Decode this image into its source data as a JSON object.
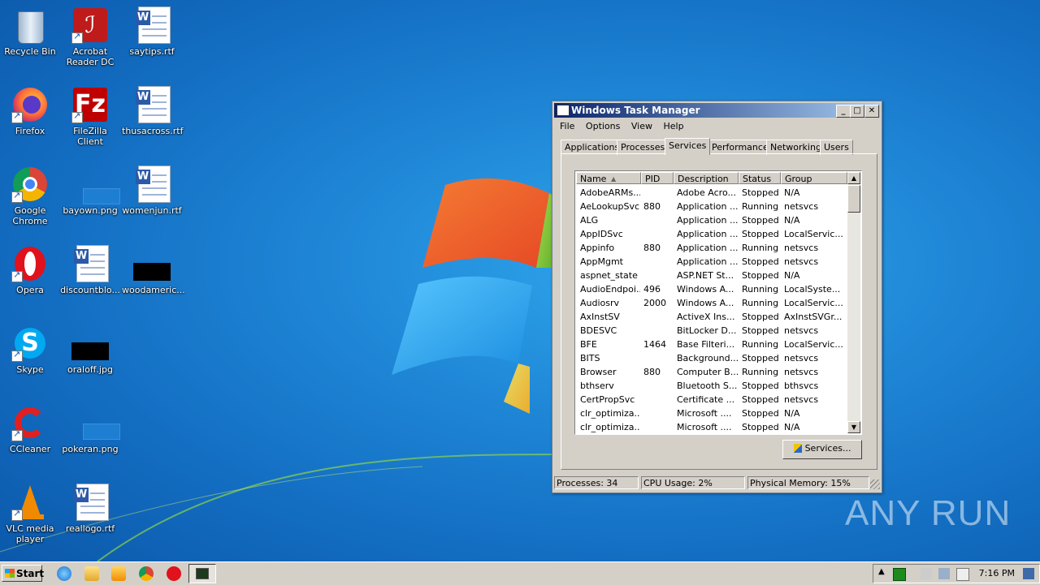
{
  "desktop": {
    "icons": [
      {
        "label": "Recycle Bin"
      },
      {
        "label": "Acrobat Reader DC"
      },
      {
        "label": "saytips.rtf"
      },
      {
        "label": "Firefox"
      },
      {
        "label": "FileZilla Client"
      },
      {
        "label": "thusacross.rtf"
      },
      {
        "label": "Google Chrome"
      },
      {
        "label": "bayown.png"
      },
      {
        "label": "womenjun.rtf"
      },
      {
        "label": "Opera"
      },
      {
        "label": "discountblo..."
      },
      {
        "label": "woodameric..."
      },
      {
        "label": "Skype"
      },
      {
        "label": "oraloff.jpg"
      },
      {
        "label": "CCleaner"
      },
      {
        "label": "pokeran.png"
      },
      {
        "label": "VLC media player"
      },
      {
        "label": "reallogo.rtf"
      }
    ]
  },
  "task_manager": {
    "title": "Windows Task Manager",
    "menu": [
      "File",
      "Options",
      "View",
      "Help"
    ],
    "tabs": [
      "Applications",
      "Processes",
      "Services",
      "Performance",
      "Networking",
      "Users"
    ],
    "active_tab": "Services",
    "columns": [
      "Name",
      "PID",
      "Description",
      "Status",
      "Group"
    ],
    "rows": [
      [
        "AdobeARMs...",
        "",
        "Adobe Acro...",
        "Stopped",
        "N/A"
      ],
      [
        "AeLookupSvc",
        "880",
        "Application ...",
        "Running",
        "netsvcs"
      ],
      [
        "ALG",
        "",
        "Application ...",
        "Stopped",
        "N/A"
      ],
      [
        "AppIDSvc",
        "",
        "Application ...",
        "Stopped",
        "LocalServic..."
      ],
      [
        "Appinfo",
        "880",
        "Application ...",
        "Running",
        "netsvcs"
      ],
      [
        "AppMgmt",
        "",
        "Application ...",
        "Stopped",
        "netsvcs"
      ],
      [
        "aspnet_state",
        "",
        "ASP.NET St...",
        "Stopped",
        "N/A"
      ],
      [
        "AudioEndpoi...",
        "496",
        "Windows A...",
        "Running",
        "LocalSyste..."
      ],
      [
        "Audiosrv",
        "2000",
        "Windows A...",
        "Running",
        "LocalServic..."
      ],
      [
        "AxInstSV",
        "",
        "ActiveX Ins...",
        "Stopped",
        "AxInstSVGr..."
      ],
      [
        "BDESVC",
        "",
        "BitLocker D...",
        "Stopped",
        "netsvcs"
      ],
      [
        "BFE",
        "1464",
        "Base Filteri...",
        "Running",
        "LocalServic..."
      ],
      [
        "BITS",
        "",
        "Background...",
        "Stopped",
        "netsvcs"
      ],
      [
        "Browser",
        "880",
        "Computer B...",
        "Running",
        "netsvcs"
      ],
      [
        "bthserv",
        "",
        "Bluetooth S...",
        "Stopped",
        "bthsvcs"
      ],
      [
        "CertPropSvc",
        "",
        "Certificate ...",
        "Stopped",
        "netsvcs"
      ],
      [
        "clr_optimiza...",
        "",
        "Microsoft ....",
        "Stopped",
        "N/A"
      ],
      [
        "clr_optimiza...",
        "",
        "Microsoft ....",
        "Stopped",
        "N/A"
      ]
    ],
    "services_button": "Services...",
    "status": {
      "processes": "Processes: 34",
      "cpu": "CPU Usage: 2%",
      "memory": "Physical Memory: 15%"
    }
  },
  "taskbar": {
    "start_label": "Start",
    "clock": "7:16 PM"
  },
  "watermark": "ANY RUN"
}
